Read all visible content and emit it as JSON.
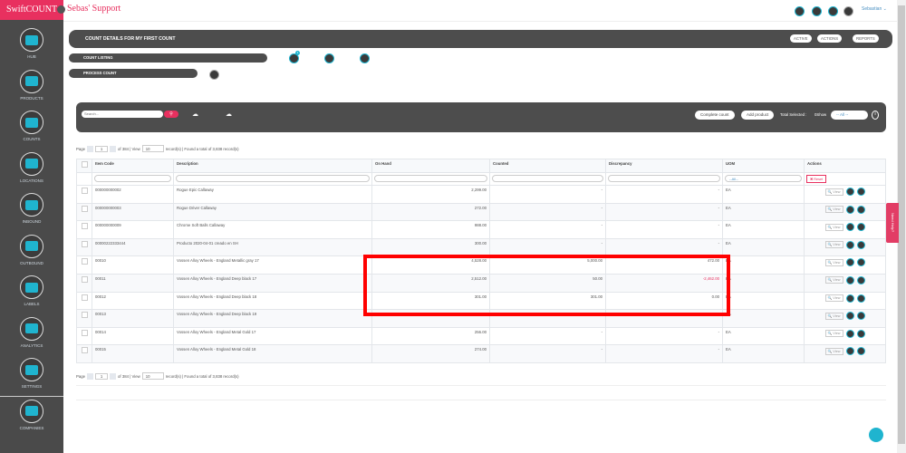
{
  "app": {
    "logo": "SwiftCOUNT",
    "brand": "Sebas' Support",
    "user": "Sebastian ⌄"
  },
  "sidebar": [
    {
      "label": "HUB"
    },
    {
      "label": "PRODUCTS"
    },
    {
      "label": "COUNTS"
    },
    {
      "label": "LOCATIONS"
    },
    {
      "label": "INBOUND"
    },
    {
      "label": "OUTBOUND"
    },
    {
      "label": "LABELS"
    },
    {
      "label": "ANALYTICS"
    },
    {
      "label": "SETTINGS"
    },
    {
      "label": "COMPANIES"
    }
  ],
  "title": {
    "text": "COUNT DETAILS FOR MY FIRST COUNT",
    "active": "ACTIVE",
    "actions": "ACTIONS",
    "reports": "REPORTS"
  },
  "nav": {
    "count_listing": "COUNT LISTING",
    "process_count": "PROCESS COUNT",
    "badge": "1"
  },
  "toolbar": {
    "search_placeholder": "Search...",
    "complete": "Complete count",
    "add": "Add product",
    "total_selected": "Total Selected :",
    "show": "0Show",
    "show_value": "-- All --"
  },
  "pager": {
    "page_label": "Page",
    "page": "1",
    "of": "of 384 | View",
    "view": "10",
    "found": "record(s) | Found a total of 3,838 record(s)"
  },
  "table": {
    "headers": [
      "Item Code",
      "Description",
      "On Hand",
      "Counted",
      "Discrepancy",
      "UOM",
      "Actions"
    ],
    "uom_filter": "--All--",
    "reset": "✖ Reset",
    "view": "🔍 View",
    "rows": [
      {
        "code": "000000000002",
        "desc": "Rogue Epic Callaway",
        "on_hand": "2,299.00",
        "counted": "-",
        "disc": "-",
        "uom": "EA"
      },
      {
        "code": "000000000003",
        "desc": "Rogue Driver Callaway",
        "on_hand": "272.00",
        "counted": "-",
        "disc": "-",
        "uom": "EA"
      },
      {
        "code": "000000000009",
        "desc": "Chrome Soft Balls Callaway",
        "on_hand": "988.00",
        "counted": "-",
        "disc": "-",
        "uom": "EA"
      },
      {
        "code": "00000222333444",
        "desc": "Producto 2020-04-01 creado en SH",
        "on_hand": "300.00",
        "counted": "-",
        "disc": "-",
        "uom": "EA"
      },
      {
        "code": "00010",
        "desc": "Vossen Alloy Wheels - England Metallic gray 17",
        "on_hand": "4,528.00",
        "counted": "5,000.00",
        "disc": "472.00",
        "uom": "EA"
      },
      {
        "code": "00011",
        "desc": "Vossen Alloy Wheels - England Deep black 17",
        "on_hand": "2,512.00",
        "counted": "50.00",
        "disc": "-2,462.00",
        "uom": "EA"
      },
      {
        "code": "00012",
        "desc": "Vossen Alloy Wheels - England Deep black 18",
        "on_hand": "301.00",
        "counted": "301.00",
        "disc": "0.00",
        "uom": "EA"
      },
      {
        "code": "00013",
        "desc": "Vossen Alloy Wheels - England Deep black 19",
        "on_hand": "",
        "counted": "-",
        "disc": "-",
        "uom": "EA"
      },
      {
        "code": "00014",
        "desc": "Vossen Alloy Wheels - England Metal Gold 17",
        "on_hand": "256.00",
        "counted": "-",
        "disc": "-",
        "uom": "EA"
      },
      {
        "code": "00015",
        "desc": "Vossen Alloy Wheels - England Metal Gold 18",
        "on_hand": "274.00",
        "counted": "-",
        "disc": "-",
        "uom": "EA"
      }
    ]
  },
  "help": "Need Help?",
  "colors": {
    "brand": "#e8305f",
    "accent": "#1fb4cf",
    "negative": "#e8305f",
    "highlight": "#ff0000"
  }
}
